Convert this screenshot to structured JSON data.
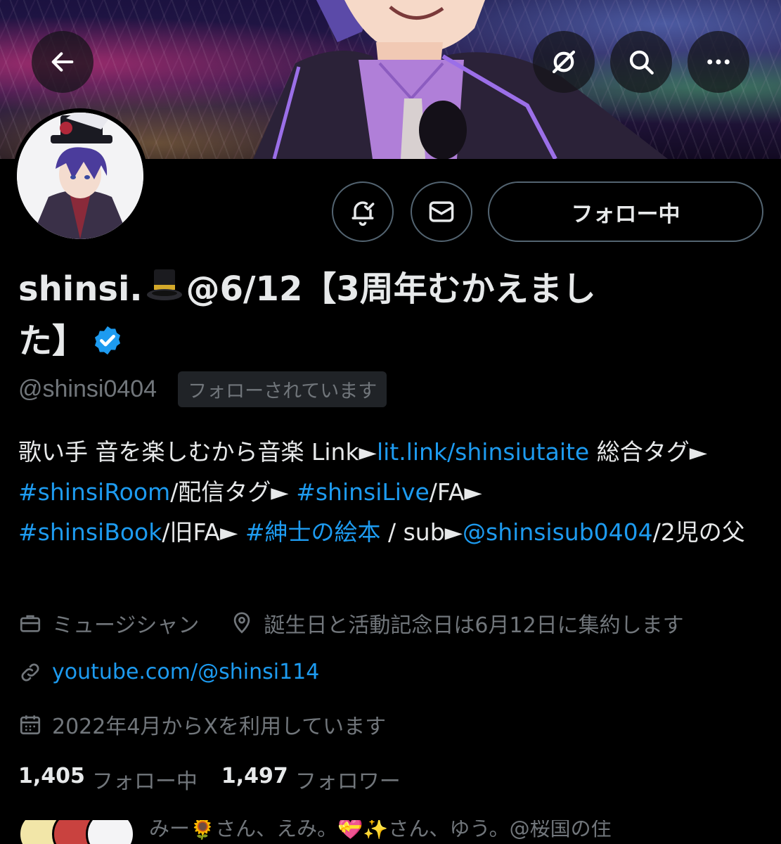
{
  "header": {
    "back_icon": "arrow-left-icon",
    "grok_icon": "grok-icon",
    "search_icon": "search-icon",
    "more_icon": "more-horizontal-icon"
  },
  "actions": {
    "notify_icon": "bell-check-icon",
    "message_icon": "mail-icon",
    "follow_label": "フォロー中"
  },
  "profile": {
    "name_part1": "shinsi.",
    "name_emoji": "top-hat-emoji",
    "name_part2": "@6/12【3周年むかえまし",
    "name_part3": "た】",
    "verified": true,
    "handle": "@shinsi0404",
    "follows_you": "フォローされています"
  },
  "bio": {
    "t1": "歌い手 音を楽しむから音楽 Link►",
    "link1": "lit.link/shinsiutaite",
    "t2": " 総合タグ► ",
    "tag1": "#shinsiRoom",
    "t3": "/配信タグ► ",
    "tag2": "#shinsiLive",
    "t4": "/FA► ",
    "tag3": "#shinsiBook",
    "t5": "/旧FA► ",
    "tag4": "#紳士の絵本",
    "t6": " / sub►",
    "mention": "@shinsisub0404",
    "t7": "/2児の父"
  },
  "meta": {
    "category": "ミュージシャン",
    "location": "誕生日と活動記念日は6月12日に集約します",
    "website": "youtube.com/@shinsi114",
    "joined": "2022年4月からXを利用しています"
  },
  "stats": {
    "following_count": "1,405",
    "following_label": "フォロー中",
    "followers_count": "1,497",
    "followers_label": "フォロワー"
  },
  "followed_by": {
    "text": "みー🌻さん、えみ。💝✨さん、ゆう。@桜国の住"
  },
  "colors": {
    "background": "#000000",
    "text": "#e7e9ea",
    "secondary": "#71767b",
    "link": "#1d9bf0",
    "border": "#536471"
  }
}
